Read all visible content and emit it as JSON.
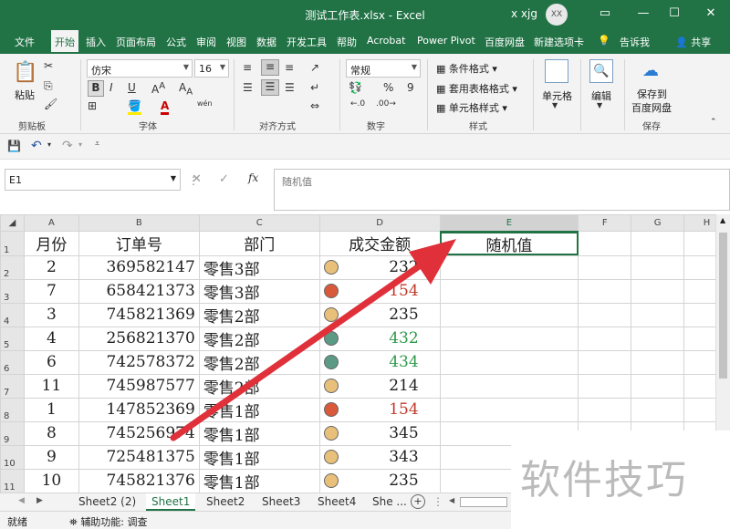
{
  "titlebar": {
    "title": "测试工作表.xlsx  -  Excel",
    "user": "x xjg",
    "avatar_initials": "XX"
  },
  "menu": [
    "文件",
    "开始",
    "插入",
    "页面布局",
    "公式",
    "审阅",
    "视图",
    "数据",
    "开发工具",
    "帮助",
    "Acrobat",
    "Power Pivot",
    "百度网盘",
    "新建选项卡",
    "告诉我",
    "共享"
  ],
  "active_menu": "开始",
  "ribbon": {
    "clipboard": {
      "paste": "粘贴",
      "label": "剪贴板"
    },
    "font": {
      "name": "仿宋",
      "size": "16",
      "label": "字体",
      "bold": "B",
      "italic": "I",
      "underline": "U",
      "font_color_letter": "A",
      "wen": "wén"
    },
    "alignment": {
      "label": "对齐方式"
    },
    "number": {
      "format": "常规",
      "label": "数字",
      "percent": "%",
      "comma": "9"
    },
    "styles": {
      "conditional": "条件格式",
      "table_format": "套用表格格式",
      "cell_styles": "单元格样式",
      "label": "样式"
    },
    "cells": {
      "label": "单元格"
    },
    "editing": {
      "label": "编辑"
    },
    "save": {
      "line1": "保存到",
      "line2": "百度网盘",
      "label": "保存"
    }
  },
  "formula_bar": {
    "name_box": "E1",
    "fx": "fx",
    "content": "随机值"
  },
  "columns": [
    "A",
    "B",
    "C",
    "D",
    "E",
    "F",
    "G",
    "H"
  ],
  "header_row": {
    "a": "月份",
    "b": "订单号",
    "c": "部门",
    "d": "成交金额",
    "e": "随机值"
  },
  "rows": [
    {
      "num": "2",
      "a": "2",
      "b": "369582147",
      "c": "零售3部",
      "d": "232",
      "color": "#e8c07a",
      "text_color": "#222"
    },
    {
      "num": "3",
      "a": "7",
      "b": "658421373",
      "c": "零售3部",
      "d": "154",
      "color": "#d9593a",
      "text_color": "#c0392b"
    },
    {
      "num": "4",
      "a": "3",
      "b": "745821369",
      "c": "零售2部",
      "d": "235",
      "color": "#e8c07a",
      "text_color": "#222"
    },
    {
      "num": "5",
      "a": "4",
      "b": "256821370",
      "c": "零售2部",
      "d": "432",
      "color": "#5b9a85",
      "text_color": "#2e9a4a"
    },
    {
      "num": "6",
      "a": "6",
      "b": "742578372",
      "c": "零售2部",
      "d": "434",
      "color": "#5b9a85",
      "text_color": "#2e9a4a"
    },
    {
      "num": "7",
      "a": "11",
      "b": "745987577",
      "c": "零售2部",
      "d": "214",
      "color": "#e8c07a",
      "text_color": "#222"
    },
    {
      "num": "8",
      "a": "1",
      "b": "147852369",
      "c": "零售1部",
      "d": "154",
      "color": "#d9593a",
      "text_color": "#c0392b"
    },
    {
      "num": "9",
      "a": "8",
      "b": "745256974",
      "c": "零售1部",
      "d": "345",
      "color": "#e8c07a",
      "text_color": "#222"
    },
    {
      "num": "10",
      "a": "9",
      "b": "725481375",
      "c": "零售1部",
      "d": "343",
      "color": "#e8c07a",
      "text_color": "#222"
    },
    {
      "num": "11",
      "a": "10",
      "b": "745821376",
      "c": "零售1部",
      "d": "235",
      "color": "#e8c07a",
      "text_color": "#222"
    }
  ],
  "sheet_tabs": [
    "Sheet2 (2)",
    "Sheet1",
    "Sheet2",
    "Sheet3",
    "Sheet4",
    "She ..."
  ],
  "active_tab": "Sheet1",
  "status": {
    "ready": "就绪",
    "accessibility": "辅助功能: 调查"
  },
  "watermark": "软件技巧"
}
